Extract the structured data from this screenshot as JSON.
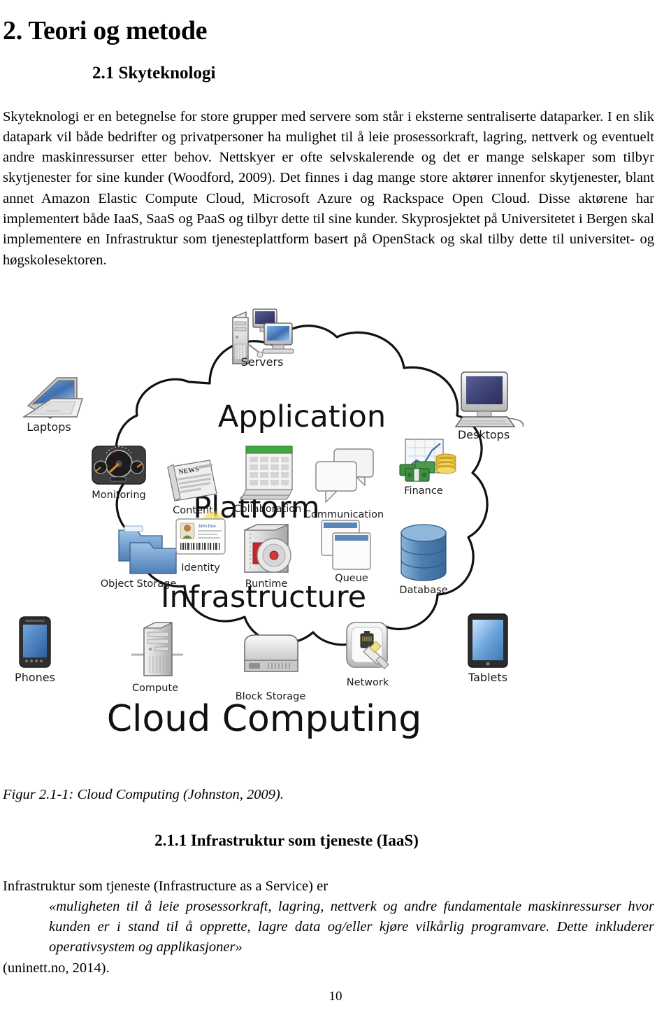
{
  "document": {
    "chapter_heading": "2. Teori og metode",
    "section_heading": "2.1 Skyteknologi",
    "subsection_heading": "2.1.1 Infrastruktur som tjeneste (IaaS)",
    "intro_paragraph": "Skyteknologi er en betegnelse for store grupper med servere som står i eksterne sentraliserte dataparker. I en slik datapark vil både bedrifter og privatpersoner ha mulighet til å leie prosessorkraft, lagring, nettverk og eventuelt andre maskinressurser etter behov. Nettskyer er ofte selvskalerende og det er mange selskaper som tilbyr skytjenester for sine kunder (Woodford, 2009). Det finnes i dag mange store aktører innenfor skytjenester, blant annet Amazon Elastic Compute Cloud, Microsoft Azure og Rackspace Open Cloud. Disse aktørene har implementert både IaaS, SaaS og PaaS og tilbyr dette til sine kunder. Skyprosjektet på Universitetet i Bergen skal implementere en Infrastruktur som tjenesteplattform basert på OpenStack og skal tilby dette til universitet- og høgskolesektoren.",
    "figure_caption": "Figur 2.1-1: Cloud Computing (Johnston, 2009).",
    "iaas_lead_in": "Infrastruktur som tjeneste (Infrastructure as a Service) er",
    "iaas_quote": "«muligheten til å leie prosessorkraft, lagring, nettverk og andre fundamentale maskinressurser hvor kunden er i stand til å opprette, lagre data og/eller kjøre vilkårlig programvare. Dette inkluderer operativsystem og applikasjoner»",
    "iaas_source": "(uninett.no, 2014).",
    "page_number": "10"
  },
  "figure": {
    "title_label": "Cloud Computing",
    "tiers": [
      {
        "id": "application",
        "label": "Application"
      },
      {
        "id": "platform",
        "label": "Platform"
      },
      {
        "id": "infrastructure",
        "label": "Infrastructure"
      }
    ],
    "external_nodes": [
      {
        "id": "servers",
        "label": "Servers",
        "icon": "server-tower-and-monitors-icon"
      },
      {
        "id": "laptops",
        "label": "Laptops",
        "icon": "laptop-icon"
      },
      {
        "id": "desktops",
        "label": "Desktops",
        "icon": "desktop-computer-icon"
      },
      {
        "id": "phones",
        "label": "Phones",
        "icon": "smartphone-icon"
      },
      {
        "id": "tablets",
        "label": "Tablets",
        "icon": "tablet-icon"
      }
    ],
    "application_nodes": [
      {
        "id": "monitoring",
        "label": "Monitoring",
        "icon": "gauge-dashboard-icon"
      },
      {
        "id": "content",
        "label": "Content",
        "icon": "newspaper-icon"
      },
      {
        "id": "collaboration",
        "label": "Collaboration",
        "icon": "spreadsheet-icon"
      },
      {
        "id": "communication",
        "label": "Communication",
        "icon": "speech-bubbles-icon"
      },
      {
        "id": "finance",
        "label": "Finance",
        "icon": "money-and-chart-icon"
      }
    ],
    "platform_nodes": [
      {
        "id": "object-storage",
        "label": "Object Storage",
        "icon": "folders-icon"
      },
      {
        "id": "identity",
        "label": "Identity",
        "icon": "id-card-icon"
      },
      {
        "id": "runtime",
        "label": "Runtime",
        "icon": "disc-drive-icon"
      },
      {
        "id": "queue",
        "label": "Queue",
        "icon": "stacked-windows-icon"
      },
      {
        "id": "database",
        "label": "Database",
        "icon": "database-cylinder-icon"
      }
    ],
    "infrastructure_nodes": [
      {
        "id": "compute",
        "label": "Compute",
        "icon": "server-rack-icon"
      },
      {
        "id": "block-storage",
        "label": "Block Storage",
        "icon": "hard-disk-icon"
      },
      {
        "id": "network",
        "label": "Network",
        "icon": "ethernet-jack-icon"
      }
    ],
    "colors": {
      "outline": "#111111",
      "folder_blue": "#5b8ec4",
      "database_blue": "#4f7fae",
      "money_green": "#3e8b3e",
      "coin_gold": "#e3c03a",
      "screen_blue": "#3c6fb0",
      "spreadsheet_green": "#3faa3f",
      "device_dark": "#2b2b2b",
      "metal_grey": "#cfcfcf"
    }
  }
}
